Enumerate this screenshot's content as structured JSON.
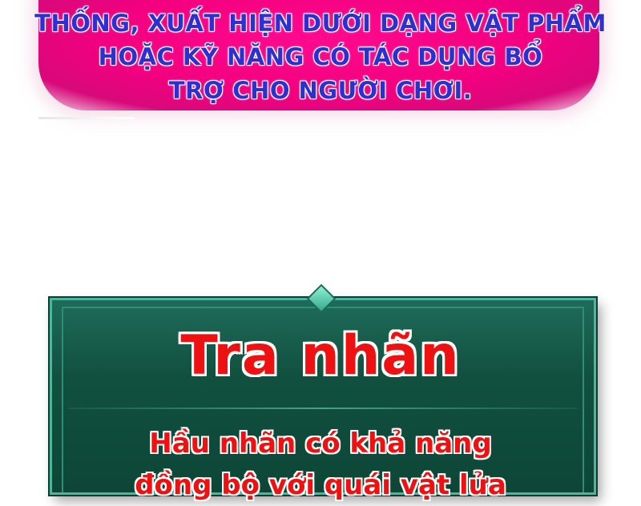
{
  "caption": {
    "lines": [
      "THỐNG, XUẤT HIỆN DƯỚI DẠNG VẬT PHẨM",
      "HOẶC KỸ NĂNG CÓ TÁC DỤNG BỔ",
      "TRỢ CHO NGƯỜI CHƠI."
    ]
  },
  "info_box": {
    "title": "Tra nhãn",
    "description_lines": [
      "Hầu nhãn có khả năng",
      "đồng bộ với quái vật lửa"
    ]
  },
  "colors": {
    "caption_panel": "#f2007f",
    "caption_text": "#2f2fcf",
    "box_background": "#11503f",
    "box_border": "#4fb49c",
    "title_text": "#ee1111"
  }
}
